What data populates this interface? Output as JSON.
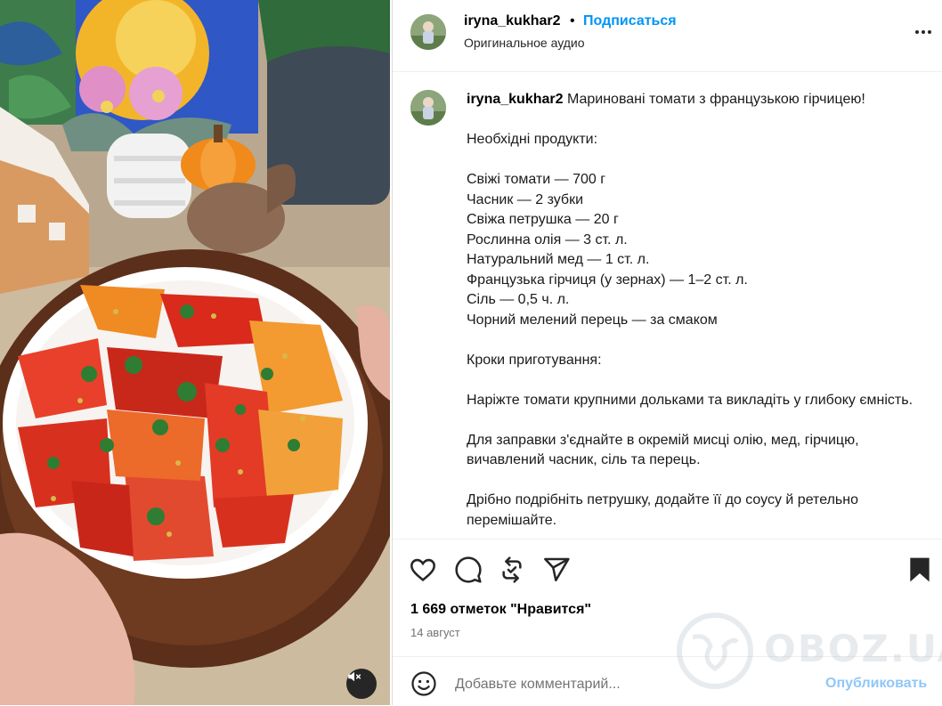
{
  "header": {
    "username": "iryna_kukhar2",
    "separator": "•",
    "follow_label": "Подписаться",
    "audio_label": "Оригинальное аудио"
  },
  "caption": {
    "username": "iryna_kukhar2",
    "title": "Мариновані томати з французькою гірчицею!",
    "body": "\n\nНеобхідні продукти:\n\nСвіжі томати — 700 г\nЧасник — 2 зубки\nСвіжа петрушка — 20 г\nРослинна олія — 3 ст. л.\nНатуральний мед — 1 ст. л.\nФранцузька гірчиця (у зернах) — 1–2 ст. л.\nСіль — 0,5 ч. л.\nЧорний мелений перець — за смаком\n\nКроки приготування:\n\nНаріжте томати крупними дольками та викладіть у глибоку ємність.\n\nДля заправки з'єднайте в окремій мисці олію, мед, гірчицю, вичавлений часник, сіль та перець.\n\nДрібно подрібніть петрушку, додайте її до соусу й ретельно перемішайте."
  },
  "stats": {
    "likes": "1 669 отметок \"Нравится\"",
    "date": "14 август"
  },
  "comment": {
    "placeholder": "Добавьте комментарий...",
    "publish_label": "Опубликовать"
  },
  "watermark": {
    "text": "OBOZ.UA"
  },
  "icons": {
    "more": "more-horizontal-icon",
    "like": "heart-icon",
    "comment": "comment-icon",
    "repost": "repost-icon",
    "share": "send-icon",
    "save": "bookmark-icon",
    "emoji": "emoji-icon",
    "mute": "sound-off-icon"
  },
  "colors": {
    "link_blue": "#0095f6",
    "publish_disabled": "#8fc7f7",
    "secondary_text": "#737373",
    "divider": "#efefef"
  }
}
